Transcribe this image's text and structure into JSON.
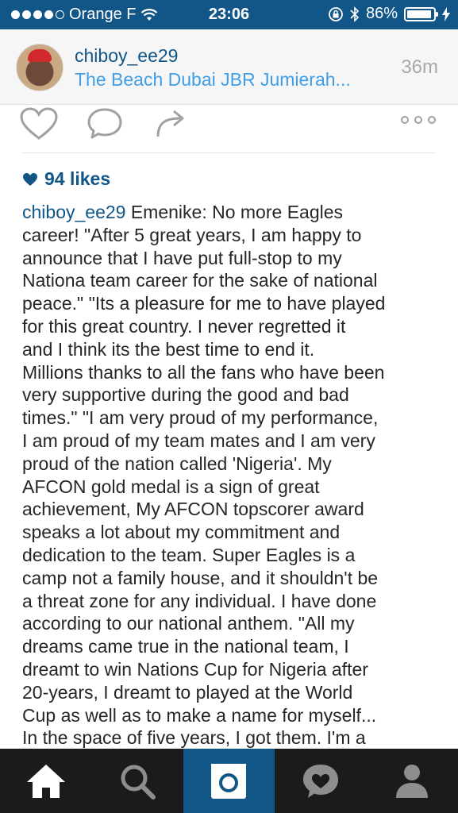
{
  "status_bar": {
    "carrier": "Orange F",
    "time": "23:06",
    "battery": "86%",
    "battery_level": 0.86
  },
  "post_header": {
    "username": "chiboy_ee29",
    "location": "The Beach Dubai JBR Jumierah...",
    "age": "36m"
  },
  "actions": {
    "like_icon": "heart-icon",
    "comment_icon": "comment-icon",
    "share_icon": "share-icon",
    "more_icon": "more-icon"
  },
  "likes": {
    "text": "94 likes"
  },
  "caption": {
    "username": "chiboy_ee29",
    "lines": [
      " Emenike: No more Eagles",
      "career! \"After 5 great years, I am happy to",
      "announce that I have put full-stop to my",
      "Nationa team career for the sake of national",
      "peace.\" \"Its a pleasure for me to have played",
      "for this great country. I never regretted it",
      "and I think its the best time to end it.",
      "Millions thanks to all the fans who have been",
      "very supportive during the good and bad",
      "times.\" \"I am very proud of my performance,",
      "I am proud of my team mates and I am very",
      "proud of the nation called 'Nigeria'. My",
      "AFCON gold medal is a sign of great",
      "achievement, My AFCON topscorer award",
      "speaks a lot about my commitment and",
      "dedication to the team.  Super Eagles is a",
      "camp not a family house, and it shouldn't be",
      "a threat zone for any individual. I have done",
      "according to our national anthem. \"All my",
      "dreams came true in the national team, I",
      "dreamt to win Nations Cup for Nigeria after",
      "20-years, I dreamt to played at the World",
      "Cup as well as to make a name for myself...",
      "In the space of five years, I got them. I'm a"
    ]
  },
  "tab_bar": {
    "tabs": [
      "home-icon",
      "search-icon",
      "camera-icon",
      "activity-icon",
      "profile-icon"
    ],
    "active_index": 2
  },
  "colors": {
    "brand_blue": "#125688",
    "location_blue": "#3f9ee6",
    "tabbar_bg": "#1b1b1b"
  }
}
